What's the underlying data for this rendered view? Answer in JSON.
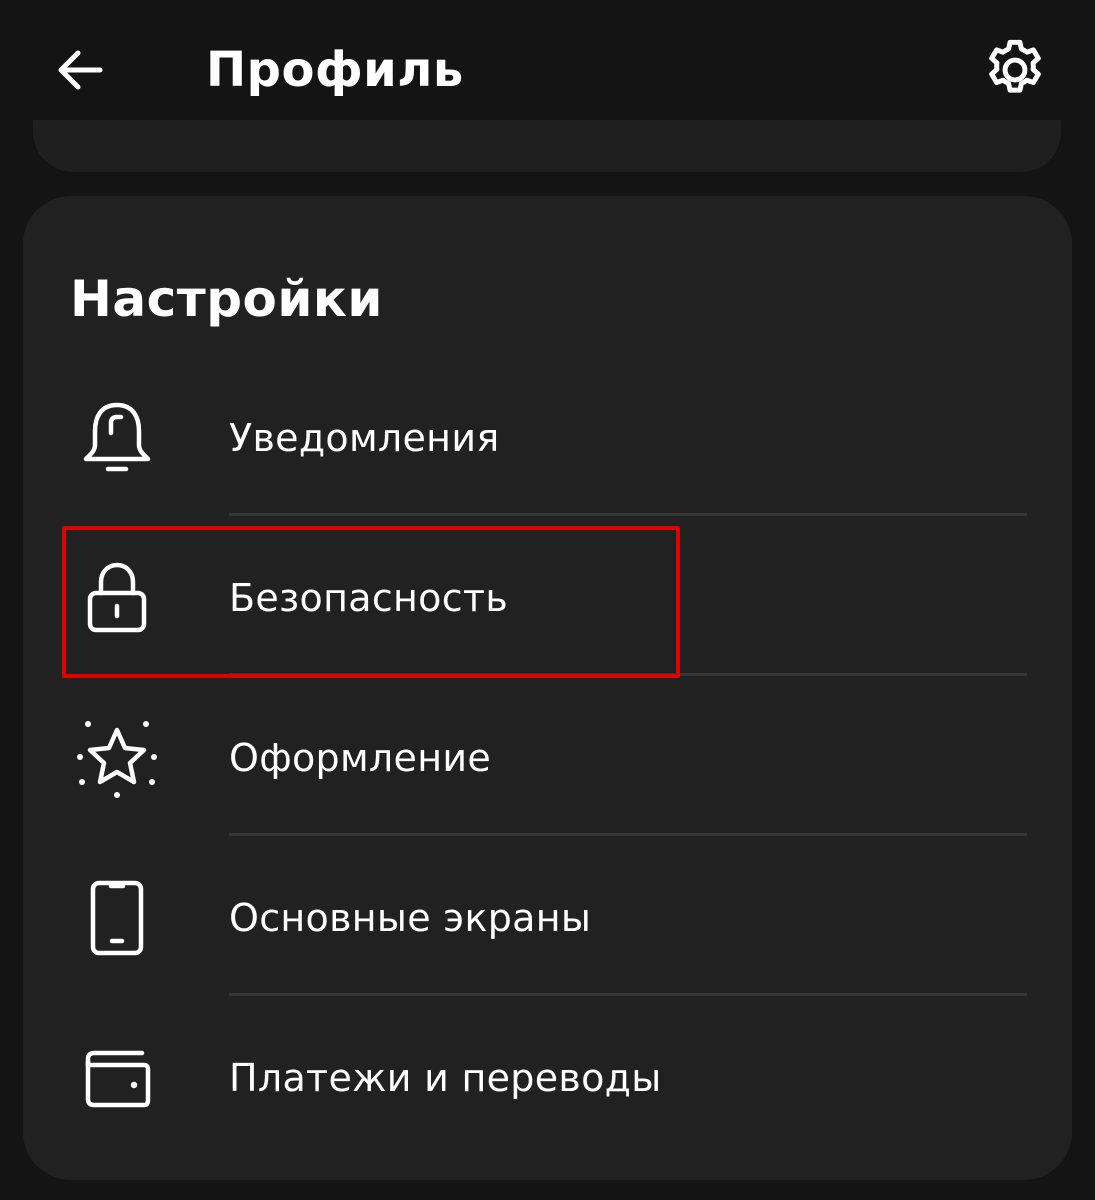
{
  "header": {
    "title": "Профиль",
    "back_icon": "arrow-left-icon",
    "settings_icon": "gear-icon"
  },
  "settings": {
    "title": "Настройки",
    "items": [
      {
        "label": "Уведомления",
        "icon": "bell-icon"
      },
      {
        "label": "Безопасность",
        "icon": "lock-icon",
        "highlighted": true
      },
      {
        "label": "Оформление",
        "icon": "sparkle-star-icon"
      },
      {
        "label": "Основные экраны",
        "icon": "smartphone-icon"
      },
      {
        "label": "Платежи и переводы",
        "icon": "wallet-icon"
      }
    ]
  },
  "colors": {
    "background": "#141414",
    "card": "#212121",
    "divider": "#363636",
    "highlight": "#e00000",
    "text": "#ffffff"
  }
}
